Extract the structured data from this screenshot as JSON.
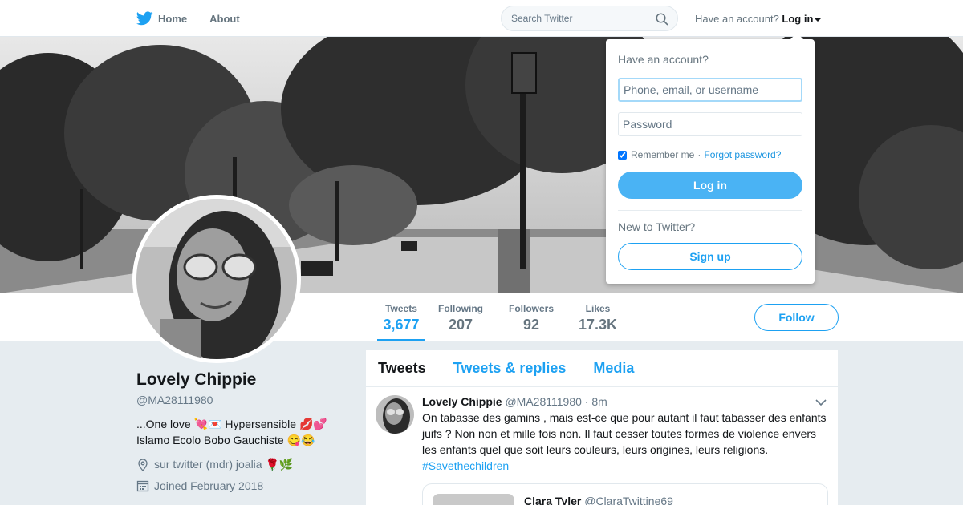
{
  "topnav": {
    "home_label": "Home",
    "about_label": "About",
    "search_placeholder": "Search Twitter",
    "account_prompt": "Have an account?",
    "login_label": "Log in"
  },
  "profile": {
    "name": "Lovely Chippie",
    "handle": "@MA28111980",
    "bio_line1": "...One love 💘💌 Hypersensible 💋💕",
    "bio_line2": "Islamo Ecolo Bobo Gauchiste 😋😂",
    "location": "sur twitter (mdr) joalia 🌹🌿",
    "joined": "Joined February 2018"
  },
  "stats": [
    {
      "label": "Tweets",
      "value": "3,677"
    },
    {
      "label": "Following",
      "value": "207"
    },
    {
      "label": "Followers",
      "value": "92"
    },
    {
      "label": "Likes",
      "value": "17.3K"
    }
  ],
  "follow_label": "Follow",
  "timeline": {
    "tabs": [
      "Tweets",
      "Tweets & replies",
      "Media"
    ],
    "tweet": {
      "name": "Lovely Chippie",
      "handle": "@MA28111980",
      "time": "· 8m",
      "text": "On tabasse des gamins , mais est-ce que pour autant il faut tabasser des enfants juifs ? Non non et mille fois non. Il faut cesser toutes formes de violence envers les enfants quel que soit leurs couleurs, leurs origines, leurs religions.",
      "hashtag": "#Savethechildren",
      "quote_name": "Clara Tyler",
      "quote_handle": "@ClaraTwittine69"
    }
  },
  "login_dropdown": {
    "title": "Have an account?",
    "username_placeholder": "Phone, email, or username",
    "password_placeholder": "Password",
    "remember_label": "Remember me",
    "separator": "·",
    "forgot_label": "Forgot password?",
    "login_button": "Log in",
    "new_prompt": "New to Twitter?",
    "signup_button": "Sign up"
  },
  "colors": {
    "accent": "#1da1f2",
    "login_button": "#4ab3f4",
    "background": "#e6ecf0"
  }
}
